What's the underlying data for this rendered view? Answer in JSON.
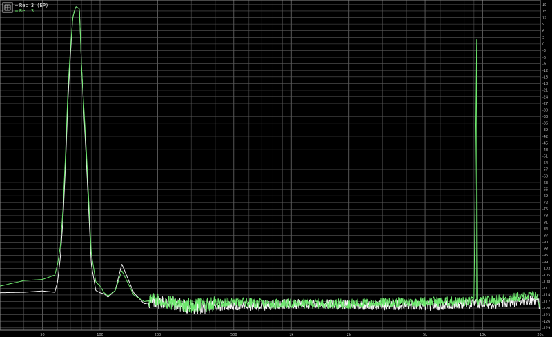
{
  "legend": {
    "entries": [
      {
        "label": "Rec 3 (EP)",
        "color": "#f4f4f4"
      },
      {
        "label": "Rec 3",
        "color": "#6ee86e"
      }
    ]
  },
  "chart_data": {
    "type": "line",
    "title": "",
    "xlabel": "",
    "ylabel": "",
    "x_scale": "log",
    "xlim": [
      30,
      20000
    ],
    "ylim": [
      -130,
      20
    ],
    "grid": true,
    "legend_position": "top-left",
    "x_ticks": [
      "50",
      "100",
      "200",
      "500",
      "1k",
      "2k",
      "5k",
      "10k",
      "20k"
    ],
    "y_ticks": [
      "18",
      "15",
      "12",
      "9",
      "6",
      "3",
      "0",
      "-3",
      "-6",
      "-9",
      "-12",
      "-15",
      "-18",
      "-21",
      "-24",
      "-27",
      "-30",
      "-33",
      "-36",
      "-39",
      "-42",
      "-45",
      "-48",
      "-51",
      "-54",
      "-57",
      "-60",
      "-63",
      "-66",
      "-69",
      "-72",
      "-75",
      "-78",
      "-81",
      "-84",
      "-87",
      "-90",
      "-93",
      "-96",
      "-99",
      "-102",
      "-105",
      "-108",
      "-111",
      "-114",
      "-117",
      "-120",
      "-123",
      "-126",
      "-129"
    ],
    "series": [
      {
        "name": "Rec 3 (EP)",
        "color": "#f4f4f4",
        "x": [
          30,
          40,
          50,
          58,
          60,
          62,
          64,
          66,
          68,
          70,
          72,
          74,
          75,
          78,
          80,
          85,
          90,
          95,
          100,
          105,
          110,
          120,
          130,
          150,
          170,
          200,
          250,
          300,
          400,
          500,
          700,
          1000,
          2000,
          5000,
          9000,
          12000,
          19000,
          20000
        ],
        "y": [
          -113,
          -112.8,
          -112.2,
          -112.8,
          -108,
          -97,
          -80,
          -55,
          -25,
          -5,
          12,
          16,
          17,
          16,
          -10,
          -55,
          -100,
          -112,
          -113,
          -113.5,
          -115,
          -112,
          -100,
          -113,
          -118,
          -117,
          -118,
          -120,
          -119,
          -119,
          -119,
          -118,
          -118.5,
          -119,
          -118,
          -118,
          -116,
          -119
        ]
      },
      {
        "name": "Rec 3",
        "color": "#6ee86e",
        "x": [
          30,
          40,
          50,
          58,
          60,
          62,
          64,
          66,
          68,
          70,
          72,
          74,
          75,
          78,
          80,
          85,
          90,
          95,
          100,
          105,
          110,
          120,
          130,
          150,
          170,
          200,
          250,
          300,
          400,
          500,
          700,
          1000,
          2000,
          5000,
          9000,
          9300,
          9400,
          9600,
          12000,
          19000,
          20000
        ],
        "y": [
          -110,
          -107.5,
          -107,
          -105,
          -100,
          -92,
          -75,
          -50,
          -20,
          -2,
          12,
          16,
          17,
          16,
          -10,
          -50,
          -95,
          -108,
          -110,
          -113,
          -114.5,
          -112,
          -103,
          -114,
          -117,
          -116,
          -118,
          -119,
          -118,
          -117,
          -118,
          -118,
          -118,
          -117,
          -117,
          2,
          -117,
          -117,
          -116,
          -114,
          -119
        ]
      }
    ]
  }
}
